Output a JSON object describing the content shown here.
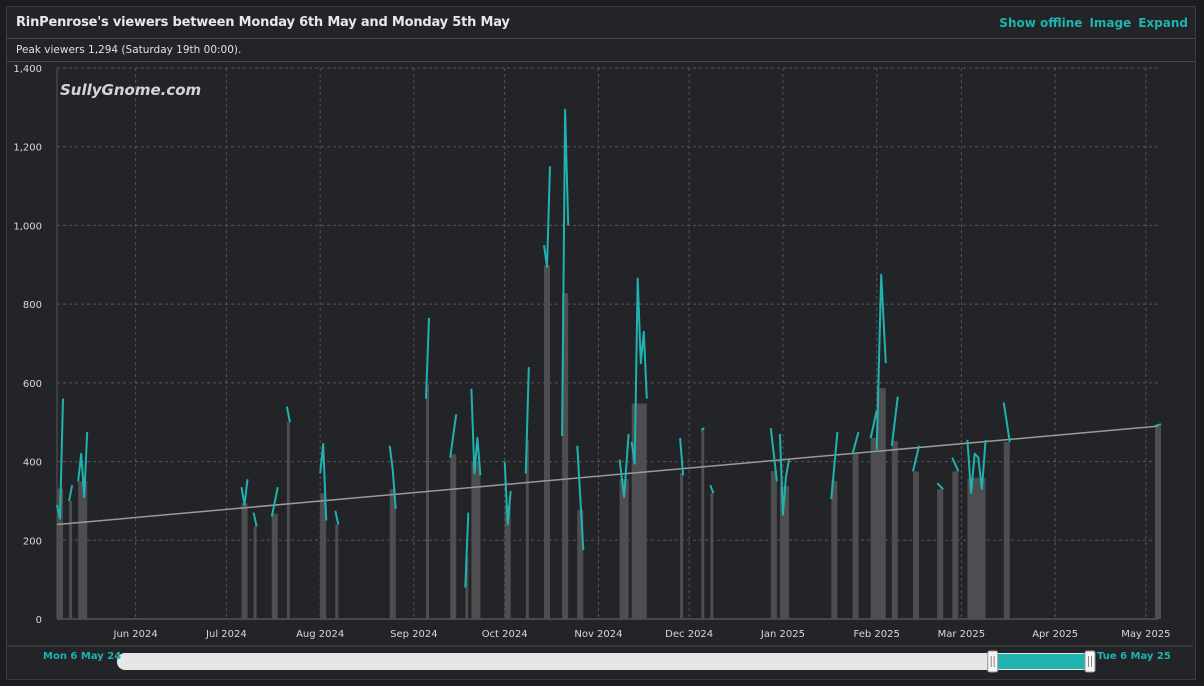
{
  "header": {
    "title": "RinPenrose's viewers between Monday 6th May and Monday 5th May",
    "show_offline": "Show offline",
    "image": "Image",
    "expand": "Expand"
  },
  "peak_text": "Peak viewers 1,294 (Saturday 19th 00:00).",
  "watermark": "SullyGnome.com",
  "navigator": {
    "start_label": "Mon 6 May 24",
    "end_label": "Tue 6 May 25",
    "selected_range": [
      0.9,
      1.0
    ]
  },
  "colors": {
    "line": "#1fb2b0",
    "bars": "#4e4e50",
    "trend": "#9a9a9a",
    "accent": "#1fb2b0"
  },
  "chart_data": {
    "type": "line",
    "x_range": [
      "2024-05-06",
      "2025-05-05"
    ],
    "ylim": [
      0,
      1400
    ],
    "y_ticks": [
      0,
      200,
      400,
      600,
      800,
      1000,
      1200,
      1400
    ],
    "y_tick_labels": [
      "0",
      "200",
      "400",
      "600",
      "800",
      "1,000",
      "1,200",
      "1,400"
    ],
    "x_ticks": [
      {
        "date": "2024-06-01",
        "label": "Jun 2024"
      },
      {
        "date": "2024-07-01",
        "label": "Jul 2024"
      },
      {
        "date": "2024-08-01",
        "label": "Aug 2024"
      },
      {
        "date": "2024-09-01",
        "label": "Sep 2024"
      },
      {
        "date": "2024-10-01",
        "label": "Oct 2024"
      },
      {
        "date": "2024-11-01",
        "label": "Nov 2024"
      },
      {
        "date": "2024-12-01",
        "label": "Dec 2024"
      },
      {
        "date": "2025-01-01",
        "label": "Jan 2025"
      },
      {
        "date": "2025-02-01",
        "label": "Feb 2025"
      },
      {
        "date": "2025-03-01",
        "label": "Mar 2025"
      },
      {
        "date": "2025-04-01",
        "label": "Apr 2025"
      },
      {
        "date": "2025-05-01",
        "label": "May 2025"
      }
    ],
    "grid": true,
    "trend_line": [
      {
        "date": "2024-05-06",
        "value": 240
      },
      {
        "date": "2025-05-05",
        "value": 490
      }
    ],
    "series": [
      {
        "streams": [
          {
            "start": "2024-05-06",
            "end": "2024-05-07",
            "values": [
              290,
              255,
              560
            ]
          },
          {
            "start": "2024-05-10",
            "end": "2024-05-10",
            "values": [
              300,
              340
            ]
          },
          {
            "start": "2024-05-13",
            "end": "2024-05-15",
            "values": [
              350,
              420,
              310,
              475
            ]
          },
          {
            "start": "2024-07-06",
            "end": "2024-07-07",
            "values": [
              335,
              290,
              355
            ]
          },
          {
            "start": "2024-07-10",
            "end": "2024-07-10",
            "values": [
              270,
              235
            ]
          },
          {
            "start": "2024-07-16",
            "end": "2024-07-17",
            "values": [
              260,
              335
            ]
          },
          {
            "start": "2024-07-21",
            "end": "2024-07-21",
            "values": [
              540,
              500
            ]
          },
          {
            "start": "2024-08-01",
            "end": "2024-08-02",
            "values": [
              370,
              445,
              250
            ]
          },
          {
            "start": "2024-08-06",
            "end": "2024-08-06",
            "values": [
              275,
              240
            ]
          },
          {
            "start": "2024-08-24",
            "end": "2024-08-25",
            "values": [
              440,
              380,
              280
            ]
          },
          {
            "start": "2024-09-05",
            "end": "2024-09-05",
            "values": [
              560,
              765
            ]
          },
          {
            "start": "2024-09-13",
            "end": "2024-09-14",
            "values": [
              410,
              520
            ]
          },
          {
            "start": "2024-09-18",
            "end": "2024-09-18",
            "values": [
              80,
              270
            ]
          },
          {
            "start": "2024-09-20",
            "end": "2024-09-22",
            "values": [
              585,
              370,
              460,
              365
            ]
          },
          {
            "start": "2024-10-01",
            "end": "2024-10-02",
            "values": [
              400,
              240,
              325
            ]
          },
          {
            "start": "2024-10-08",
            "end": "2024-10-08",
            "values": [
              370,
              640
            ]
          },
          {
            "start": "2024-10-14",
            "end": "2024-10-15",
            "values": [
              950,
              895,
              1150
            ]
          },
          {
            "start": "2024-10-20",
            "end": "2024-10-21",
            "values": [
              465,
              1294,
              1000
            ]
          },
          {
            "start": "2024-10-25",
            "end": "2024-10-26",
            "values": [
              440,
              175
            ]
          },
          {
            "start": "2024-11-08",
            "end": "2024-11-10",
            "values": [
              405,
              310,
              470
            ]
          },
          {
            "start": "2024-11-12",
            "end": "2024-11-16",
            "values": [
              450,
              395,
              865,
              650,
              730,
              560
            ]
          },
          {
            "start": "2024-11-28",
            "end": "2024-11-28",
            "values": [
              460,
              365
            ]
          },
          {
            "start": "2024-12-05",
            "end": "2024-12-05",
            "values": [
              480,
              485
            ]
          },
          {
            "start": "2024-12-08",
            "end": "2024-12-08",
            "values": [
              340,
              320
            ]
          },
          {
            "start": "2024-12-28",
            "end": "2024-12-29",
            "values": [
              485,
              350
            ]
          },
          {
            "start": "2024-12-31",
            "end": "2025-01-02",
            "values": [
              470,
              265,
              360,
              405
            ]
          },
          {
            "start": "2025-01-17",
            "end": "2025-01-18",
            "values": [
              305,
              475
            ]
          },
          {
            "start": "2025-01-24",
            "end": "2025-01-25",
            "values": [
              420,
              475
            ]
          },
          {
            "start": "2025-01-30",
            "end": "2025-01-31",
            "values": [
              460,
              530
            ]
          },
          {
            "start": "2025-02-01",
            "end": "2025-02-03",
            "values": [
              430,
              875,
              650
            ]
          },
          {
            "start": "2025-02-06",
            "end": "2025-02-07",
            "values": [
              440,
              565
            ]
          },
          {
            "start": "2025-02-13",
            "end": "2025-02-14",
            "values": [
              375,
              440
            ]
          },
          {
            "start": "2025-02-21",
            "end": "2025-02-22",
            "values": [
              345,
              330
            ]
          },
          {
            "start": "2025-02-26",
            "end": "2025-02-27",
            "values": [
              410,
              375
            ]
          },
          {
            "start": "2025-03-03",
            "end": "2025-03-08",
            "values": [
              455,
              320,
              420,
              410,
              330,
              455
            ]
          },
          {
            "start": "2025-03-15",
            "end": "2025-03-16",
            "values": [
              550,
              450
            ]
          },
          {
            "start": "2025-05-04",
            "end": "2025-05-05",
            "values": [
              490,
              495
            ]
          }
        ]
      }
    ]
  }
}
